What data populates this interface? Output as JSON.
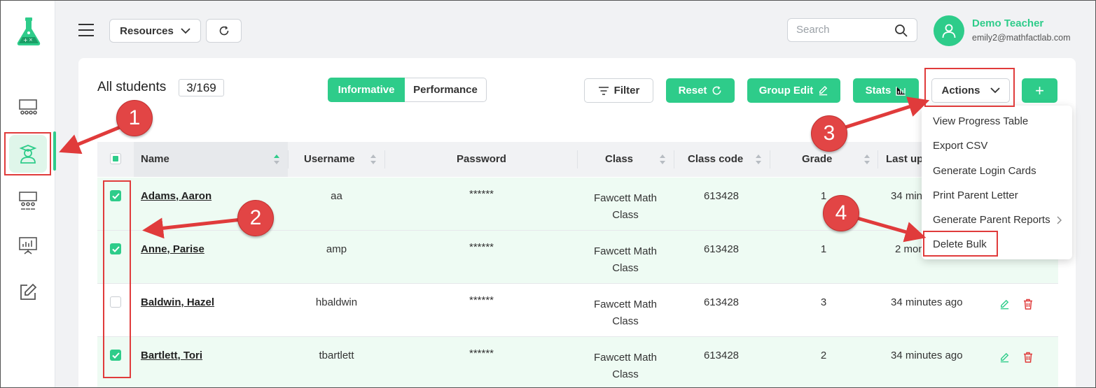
{
  "header": {
    "resources_label": "Resources",
    "search_placeholder": "Search",
    "user_name": "Demo Teacher",
    "user_email": "emily2@mathfactlab.com"
  },
  "toolbar": {
    "title": "All students",
    "count": "3/169",
    "view_informative": "Informative",
    "view_performance": "Performance",
    "filter": "Filter",
    "reset": "Reset",
    "group_edit": "Group Edit",
    "stats": "Stats",
    "actions": "Actions",
    "add": "+"
  },
  "columns": [
    "Name",
    "Username",
    "Password",
    "Class",
    "Class code",
    "Grade",
    "Last up"
  ],
  "rows": [
    {
      "name": "Adams, Aaron",
      "username": "aa",
      "password": "******",
      "class_line1": "Fawcett Math",
      "class_line2": "Class",
      "class_code": "613428",
      "grade": "1",
      "last_updated": "34 min",
      "selected": true
    },
    {
      "name": "Anne, Parise",
      "username": "amp",
      "password": "******",
      "class_line1": "Fawcett Math",
      "class_line2": "Class",
      "class_code": "613428",
      "grade": "1",
      "last_updated": "2 mon",
      "selected": true
    },
    {
      "name": "Baldwin, Hazel",
      "username": "hbaldwin",
      "password": "******",
      "class_line1": "Fawcett Math",
      "class_line2": "Class",
      "class_code": "613428",
      "grade": "3",
      "last_updated": "34 minutes ago",
      "selected": false
    },
    {
      "name": "Bartlett, Tori",
      "username": "tbartlett",
      "password": "******",
      "class_line1": "Fawcett Math",
      "class_line2": "Class",
      "class_code": "613428",
      "grade": "2",
      "last_updated": "34 minutes ago",
      "selected": true
    }
  ],
  "actions_menu": [
    "View Progress Table",
    "Export CSV",
    "Generate Login Cards",
    "Print Parent Letter",
    "Generate Parent Reports",
    "Delete Bulk"
  ],
  "callouts": [
    "1",
    "2",
    "3",
    "4"
  ],
  "colors": {
    "accent": "#2ecc8a",
    "annotation": "#e03b3b",
    "delete": "#e03b3b"
  }
}
